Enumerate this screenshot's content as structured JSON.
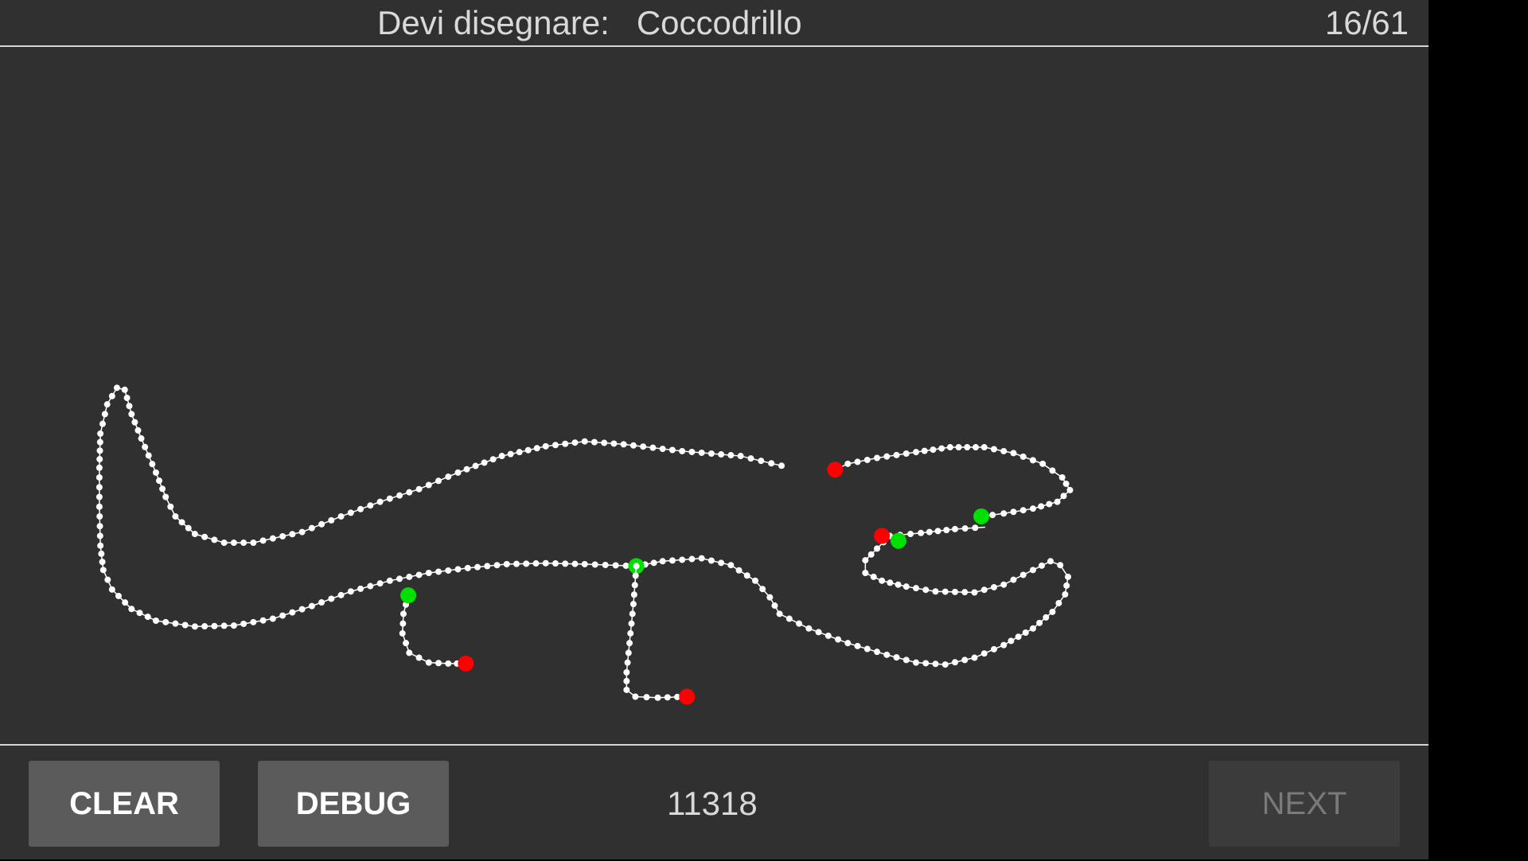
{
  "header": {
    "prompt_label": "Devi disegnare:",
    "target_word": "Coccodrillo",
    "progress": "16/61"
  },
  "footer": {
    "clear_label": "CLEAR",
    "debug_label": "DEBUG",
    "score": "11318",
    "next_label": "NEXT"
  },
  "colors": {
    "background": "#303030",
    "stroke_point": "#ffffff",
    "start_marker": "#00e000",
    "end_marker": "#ff0000",
    "button": "#5b5b5b",
    "button_disabled": "#3b3b3b"
  }
}
